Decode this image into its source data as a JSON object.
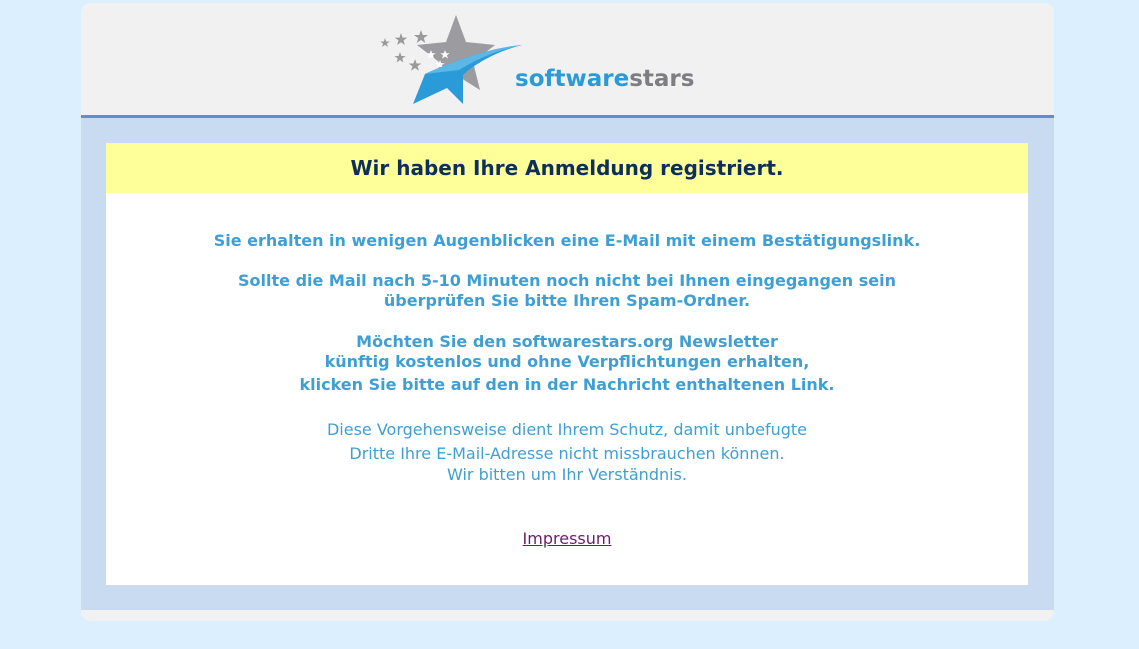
{
  "brand": {
    "logo_part1": "software",
    "logo_part2": "stars",
    "colors": {
      "blue": "#2a9bd8",
      "gray": "#7d7d82"
    }
  },
  "banner": {
    "title": "Wir haben Ihre Anmeldung registriert."
  },
  "messages": {
    "p1": "Sie erhalten in wenigen Augenblicken eine E-Mail mit einem Bestätigungslink.",
    "p2_l1": "Sollte die Mail nach 5-10 Minuten noch nicht bei Ihnen eingegangen sein",
    "p2_l2": "überprüfen Sie bitte Ihren Spam-Ordner.",
    "p3_l1": "Möchten Sie den softwarestars.org Newsletter",
    "p3_l2": "künftig kostenlos und ohne Verpflichtungen erhalten,",
    "p3_l3": "klicken Sie bitte auf den in der Nachricht enthaltenen Link.",
    "p4_l1": "Diese Vorgehensweise dient Ihrem Schutz, damit unbefugte",
    "p4_l2": "Dritte Ihre E-Mail-Adresse nicht missbrauchen können.",
    "p4_l3": "Wir bitten um Ihr Verständnis."
  },
  "footer": {
    "impressum": "Impressum"
  }
}
